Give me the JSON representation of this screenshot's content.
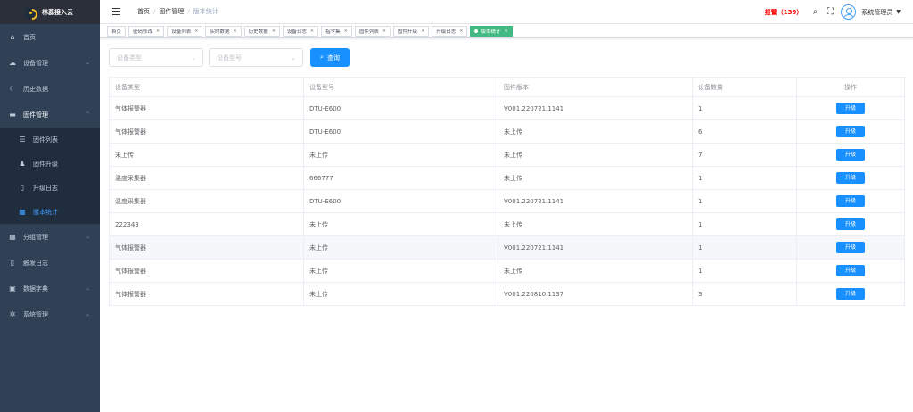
{
  "app": {
    "title": "林蕊接入云"
  },
  "sidebar": {
    "items": [
      {
        "icon": "dashboard-icon",
        "glyph": "⌂",
        "label": "首页"
      },
      {
        "icon": "cloud-icon",
        "glyph": "☁",
        "label": "设备管理",
        "arrow": "⌄"
      },
      {
        "icon": "moon-icon",
        "glyph": "☾",
        "label": "历史数据"
      },
      {
        "icon": "chip-icon",
        "glyph": "▬",
        "label": "固件管理",
        "arrow": "⌃"
      },
      {
        "icon": "apps-icon",
        "glyph": "▦",
        "label": "分组管理",
        "arrow": "⌄"
      },
      {
        "icon": "log-icon",
        "glyph": "▯",
        "label": "触发日志"
      },
      {
        "icon": "dict-icon",
        "glyph": "▣",
        "label": "数据字典",
        "arrow": "⌄"
      },
      {
        "icon": "gear-icon",
        "glyph": "✲",
        "label": "系统管理",
        "arrow": "⌄"
      }
    ],
    "sub": [
      {
        "icon": "list-icon",
        "glyph": "☰",
        "label": "固件列表"
      },
      {
        "icon": "users-icon",
        "glyph": "♟",
        "label": "固件升级"
      },
      {
        "icon": "book-icon",
        "glyph": "▯",
        "label": "升级日志"
      },
      {
        "icon": "grid-icon",
        "glyph": "▦",
        "label": "版本统计"
      }
    ]
  },
  "header": {
    "breadcrumb": [
      "首页",
      "固件管理",
      "版本统计"
    ],
    "sep": "/",
    "alarm": "报警（139）",
    "search_glyph": "⌕",
    "fullscreen_glyph": "⛶",
    "username": "系统管理员",
    "caret": "▼"
  },
  "tags": [
    {
      "label": "首页",
      "close": ""
    },
    {
      "label": "密码修改",
      "close": "×"
    },
    {
      "label": "设备列表",
      "close": "×"
    },
    {
      "label": "实时数据",
      "close": "×"
    },
    {
      "label": "历史数据",
      "close": "×"
    },
    {
      "label": "设备日志",
      "close": "×"
    },
    {
      "label": "指令集",
      "close": "×"
    },
    {
      "label": "固件列表",
      "close": "×"
    },
    {
      "label": "固件升级",
      "close": "×"
    },
    {
      "label": "升级日志",
      "close": "×"
    },
    {
      "label": "版本统计",
      "close": "×"
    }
  ],
  "filters": {
    "type_placeholder": "设备类型",
    "model_placeholder": "设备型号",
    "chevron": "⌄",
    "search_label": "查询",
    "search_glyph": "⌕"
  },
  "table": {
    "headers": [
      "设备类型",
      "设备型号",
      "固件版本",
      "设备数量",
      "操作"
    ],
    "action_label": "升级",
    "rows": [
      [
        "气体报警器",
        "DTU-E600",
        "V001.220721.1141",
        "1"
      ],
      [
        "气体报警器",
        "DTU-E600",
        "未上传",
        "6"
      ],
      [
        "未上传",
        "未上传",
        "未上传",
        "7"
      ],
      [
        "温度采集器",
        "666777",
        "未上传",
        "1"
      ],
      [
        "温度采集器",
        "DTU-E600",
        "V001.220721.1141",
        "1"
      ],
      [
        "222343",
        "未上传",
        "未上传",
        "1"
      ],
      [
        "气体报警器",
        "未上传",
        "V001.220721.1141",
        "1"
      ],
      [
        "气体报警器",
        "未上传",
        "未上传",
        "1"
      ],
      [
        "气体报警器",
        "未上传",
        "V001.220810.1137",
        "3"
      ]
    ]
  },
  "colors": {
    "sidebar": "#304156",
    "primary": "#1890ff",
    "active_tag": "#42b983",
    "alarm": "#ff0000"
  }
}
